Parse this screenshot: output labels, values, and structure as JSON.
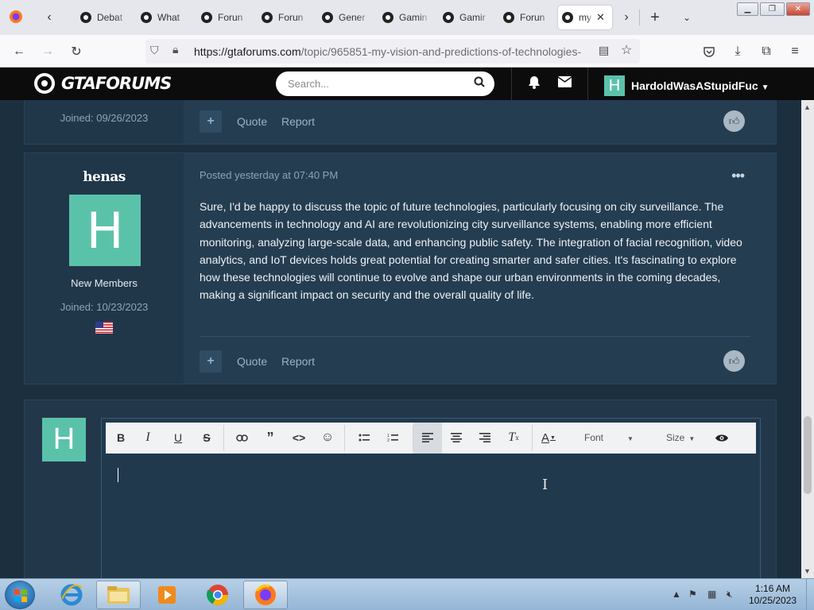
{
  "browser": {
    "tabs": [
      {
        "label": "Debat"
      },
      {
        "label": "What"
      },
      {
        "label": "Forun"
      },
      {
        "label": "Forun"
      },
      {
        "label": "Gener"
      },
      {
        "label": "Gamin"
      },
      {
        "label": "Gamir"
      },
      {
        "label": "Forun"
      },
      {
        "label": "my"
      }
    ],
    "url_host": "https://gtaforums.com",
    "url_path": "/topic/965851-my-vision-and-predictions-of-technologies-"
  },
  "site": {
    "logo_text": "GTAFORUMS",
    "search_placeholder": "Search...",
    "avatar_initial": "H",
    "username": "HardoldWasAStupidFuc"
  },
  "prev_post": {
    "joined": "Joined: 09/26/2023",
    "quote_label": "Quote",
    "report_label": "Report"
  },
  "post": {
    "author": "henas",
    "avatar_initial": "H",
    "group": "New Members",
    "joined": "Joined: 10/23/2023",
    "posted": "Posted yesterday at 07:40 PM",
    "body": "Sure, I'd be happy to discuss the topic of future technologies, particularly focusing on city surveillance. The advancements in technology and AI are revolutionizing city surveillance systems, enabling more efficient monitoring, analyzing large-scale data, and enhancing public safety. The integration of facial recognition, video analytics, and IoT devices holds great potential for creating smarter and safer cities. It's fascinating to explore how these technologies will continue to evolve and shape our urban environments in the coming decades, making a significant impact on security and the overall quality of life.",
    "quote_label": "Quote",
    "report_label": "Report"
  },
  "reply": {
    "avatar_initial": "H",
    "font_label": "Font",
    "size_label": "Size"
  },
  "taskbar": {
    "time": "1:16 AM",
    "date": "10/25/2023"
  },
  "colors": {
    "accent": "#5bc2aa",
    "page_bg": "#1b2f3f",
    "post_bg": "#253d51"
  }
}
